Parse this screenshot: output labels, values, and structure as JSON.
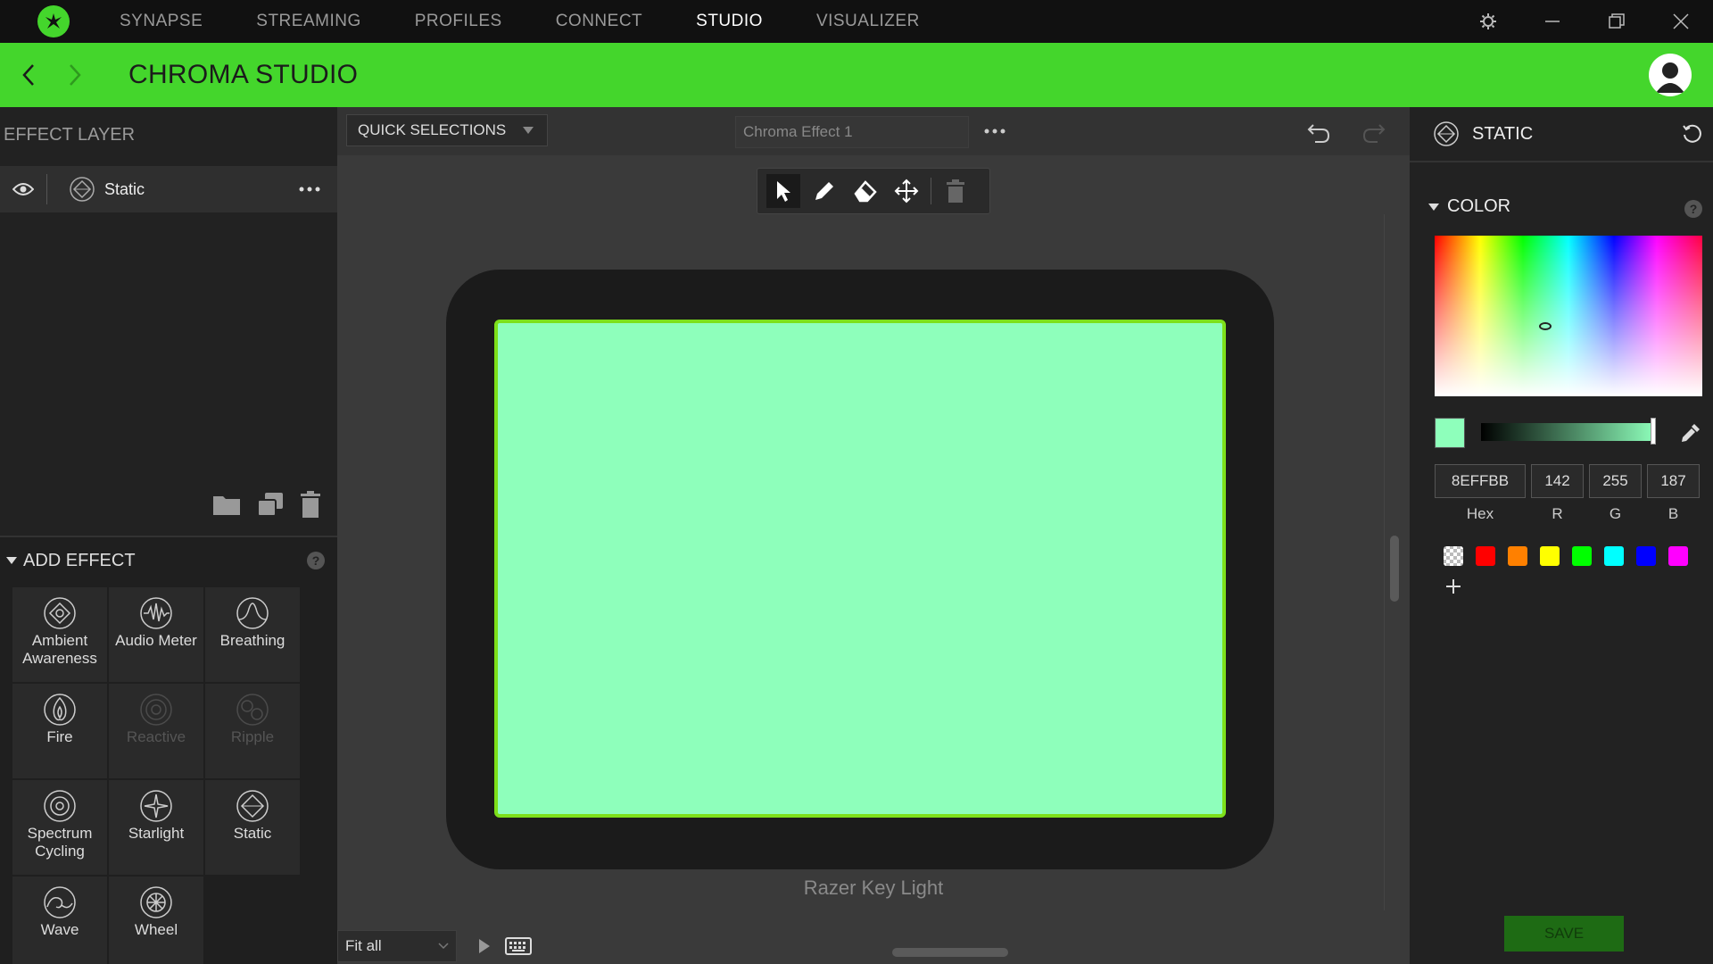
{
  "topnav": {
    "tabs": [
      {
        "label": "SYNAPSE",
        "active": false
      },
      {
        "label": "STREAMING",
        "active": false
      },
      {
        "label": "PROFILES",
        "active": false
      },
      {
        "label": "CONNECT",
        "active": false
      },
      {
        "label": "STUDIO",
        "active": true
      },
      {
        "label": "VISUALIZER",
        "active": false
      }
    ],
    "icons": [
      "razer-logo-icon",
      "settings-icon",
      "minimize-icon",
      "restore-icon",
      "close-icon"
    ]
  },
  "header": {
    "title": "CHROMA STUDIO",
    "accent": "#44d62c"
  },
  "left_panel": {
    "effect_layer_title": "EFFECT LAYER",
    "layers": [
      {
        "name": "Static",
        "visible": true
      }
    ],
    "add_effect_title": "ADD EFFECT",
    "effects": [
      {
        "label": "Ambient Awareness",
        "enabled": true,
        "icon": "ambient-awareness-icon"
      },
      {
        "label": "Audio Meter",
        "enabled": true,
        "icon": "audio-meter-icon"
      },
      {
        "label": "Breathing",
        "enabled": true,
        "icon": "breathing-icon"
      },
      {
        "label": "Fire",
        "enabled": true,
        "icon": "fire-icon"
      },
      {
        "label": "Reactive",
        "enabled": false,
        "icon": "reactive-icon"
      },
      {
        "label": "Ripple",
        "enabled": false,
        "icon": "ripple-icon"
      },
      {
        "label": "Spectrum Cycling",
        "enabled": true,
        "icon": "spectrum-cycling-icon"
      },
      {
        "label": "Starlight",
        "enabled": true,
        "icon": "starlight-icon"
      },
      {
        "label": "Static",
        "enabled": true,
        "icon": "static-icon"
      },
      {
        "label": "Wave",
        "enabled": true,
        "icon": "wave-icon"
      },
      {
        "label": "Wheel",
        "enabled": true,
        "icon": "wheel-icon"
      }
    ]
  },
  "workspace": {
    "quick_selections": "QUICK SELECTIONS",
    "effect_name": "Chroma Effect 1",
    "device_label": "Razer Key Light",
    "device_color": "#8effbb",
    "fit": "Fit all"
  },
  "right_panel": {
    "title": "STATIC",
    "color_title": "COLOR",
    "current_color": "#8effbb",
    "hex": "8EFFBB",
    "r": "142",
    "g": "255",
    "b": "187",
    "labels": {
      "hex": "Hex",
      "r": "R",
      "g": "G",
      "b": "B"
    },
    "presets": [
      "transparent",
      "#ff0000",
      "#ff8000",
      "#ffff00",
      "#00ff00",
      "#00ffff",
      "#0000ff",
      "#ff00ff"
    ],
    "save": "SAVE"
  }
}
